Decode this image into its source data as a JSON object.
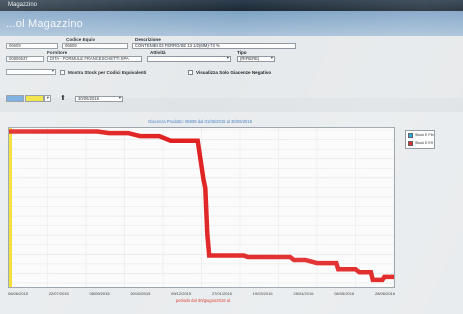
{
  "window": {
    "title": "Magazzino"
  },
  "header": {
    "title": "...ol Magazzino"
  },
  "form": {
    "row1": {
      "code_label": "Codice Equiv",
      "desc_label": "Descrizione",
      "field_a": "06609",
      "field_b": "06609",
      "field_c": "CONTENIBI 03 FERRO/SE   13 1/2(MM)-73 %"
    },
    "row2": {
      "fornitore_label": "Fornitore",
      "attivita_label": "Attività",
      "tipo_label": "Tipo",
      "field_a": "00806537",
      "field_b": "DITA - FORMULE FRANCESCHETTI SPA",
      "field_c": "",
      "field_d": "(RIFIERE)"
    },
    "row3": {
      "mostra_label": "Mostra Stock per Codici Equivalenti",
      "visualizza_label": "Visualizza Solo Giacenze Negativo"
    },
    "row4": {
      "date_value": "30/06/2016"
    }
  },
  "legend": {
    "items": [
      {
        "label": "Stock E Pib",
        "color": "#1aa3e0"
      },
      {
        "label": "Stock E Eff",
        "color": "#e02020"
      }
    ]
  },
  "chart_data": {
    "type": "line",
    "title": "Giacenza Prodotto: 06609 dal 01/06/2015 al 30/06/2016",
    "xlabel": "periodo dal 30/giugno2016 al",
    "ylabel": "",
    "x_tick_labels": [
      "06/06/2015",
      "22/07/2015",
      "05/09/2015",
      "20/10/2015",
      "09/12/2015",
      "27/01/2016",
      "19/03/2016",
      "28/04/2016",
      "08/05/2016",
      "28/06/2016"
    ],
    "ylim": [
      0,
      100
    ],
    "grid": true,
    "legend_position": "right",
    "series": [
      {
        "name": "Stock E Eff",
        "color": "#e02020",
        "points": [
          [
            0,
            99
          ],
          [
            2.3,
            99
          ],
          [
            2.6,
            98
          ],
          [
            3.1,
            98
          ],
          [
            3.4,
            96
          ],
          [
            3.9,
            96
          ],
          [
            4.2,
            93
          ],
          [
            4.9,
            93
          ],
          [
            5.05,
            68
          ],
          [
            5.1,
            62
          ],
          [
            5.15,
            32
          ],
          [
            5.2,
            18
          ],
          [
            5.3,
            18
          ],
          [
            6.1,
            18
          ],
          [
            6.2,
            17
          ],
          [
            7.3,
            17
          ],
          [
            7.4,
            15
          ],
          [
            7.7,
            15
          ],
          [
            8.0,
            13
          ],
          [
            8.5,
            13
          ],
          [
            8.55,
            9
          ],
          [
            9.0,
            9
          ],
          [
            9.1,
            7
          ],
          [
            9.4,
            7
          ],
          [
            9.45,
            2
          ],
          [
            9.7,
            2
          ],
          [
            9.75,
            4
          ],
          [
            10,
            4
          ]
        ]
      }
    ]
  }
}
